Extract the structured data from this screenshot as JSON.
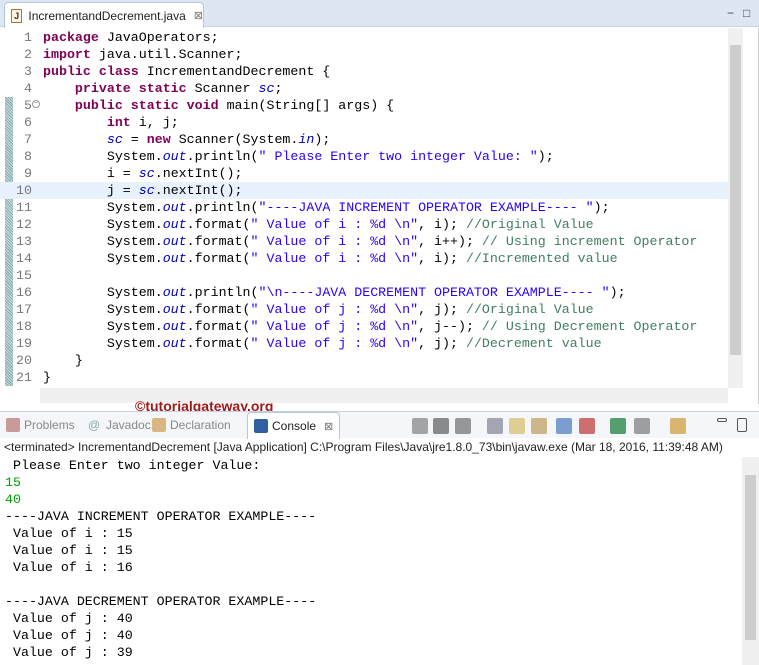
{
  "editor_tab": {
    "icon": "java-file-icon",
    "icon_text": "J",
    "title": "IncrementandDecrement.java"
  },
  "window": {
    "minimize": "−",
    "maximize": "□"
  },
  "code_lines": [
    [
      [
        "package",
        "k"
      ],
      [
        " JavaOperators;",
        ""
      ]
    ],
    [
      [
        "import",
        "k"
      ],
      [
        " java.util.Scanner;",
        ""
      ]
    ],
    [
      [
        "public",
        "k"
      ],
      [
        " ",
        ""
      ],
      [
        "class",
        "k"
      ],
      [
        " IncrementandDecrement {",
        ""
      ]
    ],
    [
      [
        "    ",
        ""
      ],
      [
        "private",
        "k"
      ],
      [
        " ",
        ""
      ],
      [
        "static",
        "k"
      ],
      [
        " Scanner ",
        ""
      ],
      [
        "sc",
        "f"
      ],
      [
        ";",
        ""
      ]
    ],
    [
      [
        "    ",
        ""
      ],
      [
        "public",
        "k"
      ],
      [
        " ",
        ""
      ],
      [
        "static",
        "k"
      ],
      [
        " ",
        ""
      ],
      [
        "void",
        "k"
      ],
      [
        " main(String[] args) {",
        ""
      ]
    ],
    [
      [
        "        ",
        ""
      ],
      [
        "int",
        "k"
      ],
      [
        " i, j;",
        ""
      ]
    ],
    [
      [
        "        ",
        ""
      ],
      [
        "sc",
        "f"
      ],
      [
        " = ",
        ""
      ],
      [
        "new",
        "k"
      ],
      [
        " Scanner(System.",
        ""
      ],
      [
        "in",
        "f"
      ],
      [
        ");",
        ""
      ]
    ],
    [
      [
        "        System.",
        ""
      ],
      [
        "out",
        "f"
      ],
      [
        ".println(",
        ""
      ],
      [
        "\" Please Enter two integer Value: \"",
        "s"
      ],
      [
        ");",
        ""
      ]
    ],
    [
      [
        "        i = ",
        ""
      ],
      [
        "sc",
        "f"
      ],
      [
        ".nextInt();",
        ""
      ]
    ],
    [
      [
        "        j = ",
        ""
      ],
      [
        "sc",
        "f"
      ],
      [
        ".nextInt();",
        ""
      ]
    ],
    [
      [
        "        System.",
        ""
      ],
      [
        "out",
        "f"
      ],
      [
        ".println(",
        ""
      ],
      [
        "\"----JAVA INCREMENT OPERATOR EXAMPLE---- \"",
        "s"
      ],
      [
        ");",
        ""
      ]
    ],
    [
      [
        "        System.",
        ""
      ],
      [
        "out",
        "f"
      ],
      [
        ".format(",
        ""
      ],
      [
        "\" Value of i : %d \\n\"",
        "s"
      ],
      [
        ", i); ",
        ""
      ],
      [
        "//Original Value",
        "c"
      ]
    ],
    [
      [
        "        System.",
        ""
      ],
      [
        "out",
        "f"
      ],
      [
        ".format(",
        ""
      ],
      [
        "\" Value of i : %d \\n\"",
        "s"
      ],
      [
        ", i++); ",
        ""
      ],
      [
        "// Using increment Operator",
        "c"
      ]
    ],
    [
      [
        "        System.",
        ""
      ],
      [
        "out",
        "f"
      ],
      [
        ".format(",
        ""
      ],
      [
        "\" Value of i : %d \\n\"",
        "s"
      ],
      [
        ", i); ",
        ""
      ],
      [
        "//Incremented value",
        "c"
      ]
    ],
    [],
    [
      [
        "        System.",
        ""
      ],
      [
        "out",
        "f"
      ],
      [
        ".println(",
        ""
      ],
      [
        "\"\\n----JAVA DECREMENT OPERATOR EXAMPLE---- \"",
        "s"
      ],
      [
        ");",
        ""
      ]
    ],
    [
      [
        "        System.",
        ""
      ],
      [
        "out",
        "f"
      ],
      [
        ".format(",
        ""
      ],
      [
        "\" Value of j : %d \\n\"",
        "s"
      ],
      [
        ", j); ",
        ""
      ],
      [
        "//Original Value",
        "c"
      ]
    ],
    [
      [
        "        System.",
        ""
      ],
      [
        "out",
        "f"
      ],
      [
        ".format(",
        ""
      ],
      [
        "\" Value of j : %d \\n\"",
        "s"
      ],
      [
        ", j--); ",
        ""
      ],
      [
        "// Using Decrement Operator",
        "c"
      ]
    ],
    [
      [
        "        System.",
        ""
      ],
      [
        "out",
        "f"
      ],
      [
        ".format(",
        ""
      ],
      [
        "\" Value of j : %d \\n\"",
        "s"
      ],
      [
        ", j); ",
        ""
      ],
      [
        "//Decrement value",
        "c"
      ]
    ],
    [
      [
        "    }",
        ""
      ]
    ],
    [
      [
        "}",
        ""
      ]
    ]
  ],
  "current_line": 10,
  "fold_line": 5,
  "watermark": "©tutorialgateway.org",
  "console_tabs": [
    {
      "label": "Problems",
      "icon": "problems-icon",
      "color": "#c89a9a"
    },
    {
      "label": "Javadoc",
      "icon": "at-sign-icon",
      "prefix": "@",
      "color": "#8aa"
    },
    {
      "label": "Declaration",
      "icon": "declaration-icon",
      "color": "#d8b880"
    },
    {
      "label": "Console",
      "icon": "console-icon",
      "color": "#3060a0",
      "active": true,
      "close": "⊠"
    }
  ],
  "toolbar": [
    "terminate-icon",
    "remove-launch-icon",
    "remove-all-terminated-icon",
    "clear-console-icon",
    "scroll-lock-icon",
    "word-wrap-icon",
    "show-on-stdout-icon",
    "show-on-stderr-icon",
    "pin-console-icon",
    "display-console-icon",
    "open-console-icon",
    "minimize-view-icon",
    "maximize-view-icon"
  ],
  "console_header": "<terminated> IncrementandDecrement [Java Application] C:\\Program Files\\Java\\jre1.8.0_73\\bin\\javaw.exe (Mar 18, 2016, 11:39:48 AM)",
  "console_output": [
    {
      "text": " Please Enter two integer Value: "
    },
    {
      "text": "15",
      "input": true
    },
    {
      "text": "40",
      "input": true
    },
    {
      "text": "----JAVA INCREMENT OPERATOR EXAMPLE---- "
    },
    {
      "text": " Value of i : 15 "
    },
    {
      "text": " Value of i : 15 "
    },
    {
      "text": " Value of i : 16 "
    },
    {
      "text": ""
    },
    {
      "text": "----JAVA DECREMENT OPERATOR EXAMPLE---- "
    },
    {
      "text": " Value of j : 40 "
    },
    {
      "text": " Value of j : 40 "
    },
    {
      "text": " Value of j : 39 "
    }
  ]
}
